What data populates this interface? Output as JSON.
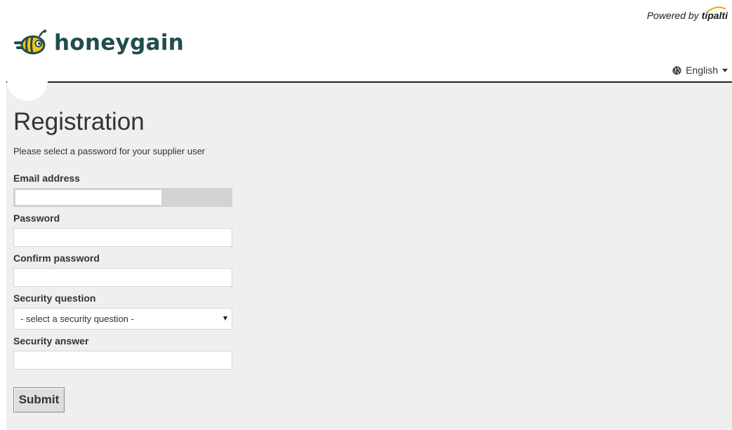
{
  "header": {
    "logo_text": "honeygain",
    "powered_prefix": "Powered by",
    "powered_brand": "tipalti",
    "language": "English"
  },
  "form": {
    "title": "Registration",
    "subtitle": "Please select a password for your supplier user",
    "email": {
      "label": "Email address",
      "value": ""
    },
    "password": {
      "label": "Password",
      "value": ""
    },
    "confirm_password": {
      "label": "Confirm password",
      "value": ""
    },
    "security_question": {
      "label": "Security question",
      "selected": "- select a security question -"
    },
    "security_answer": {
      "label": "Security answer",
      "value": ""
    },
    "submit_label": "Submit"
  },
  "colors": {
    "brand_text": "#1f4d4d",
    "bee_yellow": "#f5c518",
    "page_background": "#efefef"
  },
  "icons": [
    "bee-logo-icon",
    "globe-icon",
    "caret-down-icon",
    "select-caret-icon"
  ]
}
